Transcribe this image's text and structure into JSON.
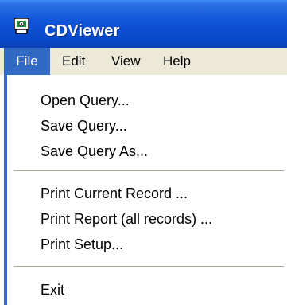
{
  "window": {
    "title": "CDViewer",
    "icon": "cd-viewer-app-icon"
  },
  "menubar": {
    "items": [
      {
        "label": "File",
        "active": true
      },
      {
        "label": "Edit",
        "active": false
      },
      {
        "label": "View",
        "active": false
      },
      {
        "label": "Help",
        "active": false
      }
    ]
  },
  "file_menu": {
    "groups": [
      [
        "Open Query...",
        "Save Query...",
        "Save Query As..."
      ],
      [
        "Print Current Record ...",
        "Print Report (all records) ...",
        "Print Setup..."
      ],
      [
        "Exit"
      ]
    ]
  },
  "colors": {
    "titlebar": "#0a48c8",
    "menubar": "#ece9d8",
    "highlight": "#316ac5",
    "separator": "#aca899"
  }
}
